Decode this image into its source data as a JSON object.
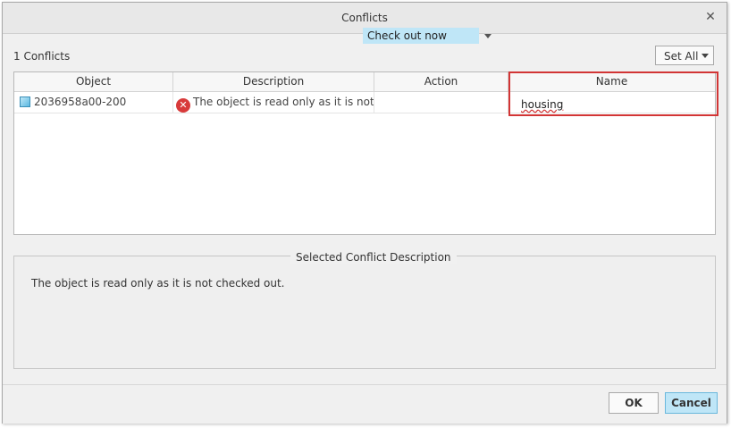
{
  "dialog": {
    "title": "Conflicts"
  },
  "summary": {
    "count_text": "1 Conflicts"
  },
  "set_all": {
    "label": "Set All"
  },
  "table": {
    "columns": [
      "Object",
      "Description",
      "Action",
      "Name"
    ],
    "rows": [
      {
        "object": "2036958a00-200",
        "description": "The object is read only as it is not checked out.",
        "action": "Check out now",
        "name": "housing"
      }
    ]
  },
  "selected_description": {
    "title": "Selected Conflict Description",
    "text": "The object is read only as it is not checked out."
  },
  "buttons": {
    "ok": "OK",
    "cancel": "Cancel"
  },
  "colors": {
    "accent": "#bfe6f7",
    "highlight_border": "#d23535",
    "error": "#d83a3a"
  }
}
